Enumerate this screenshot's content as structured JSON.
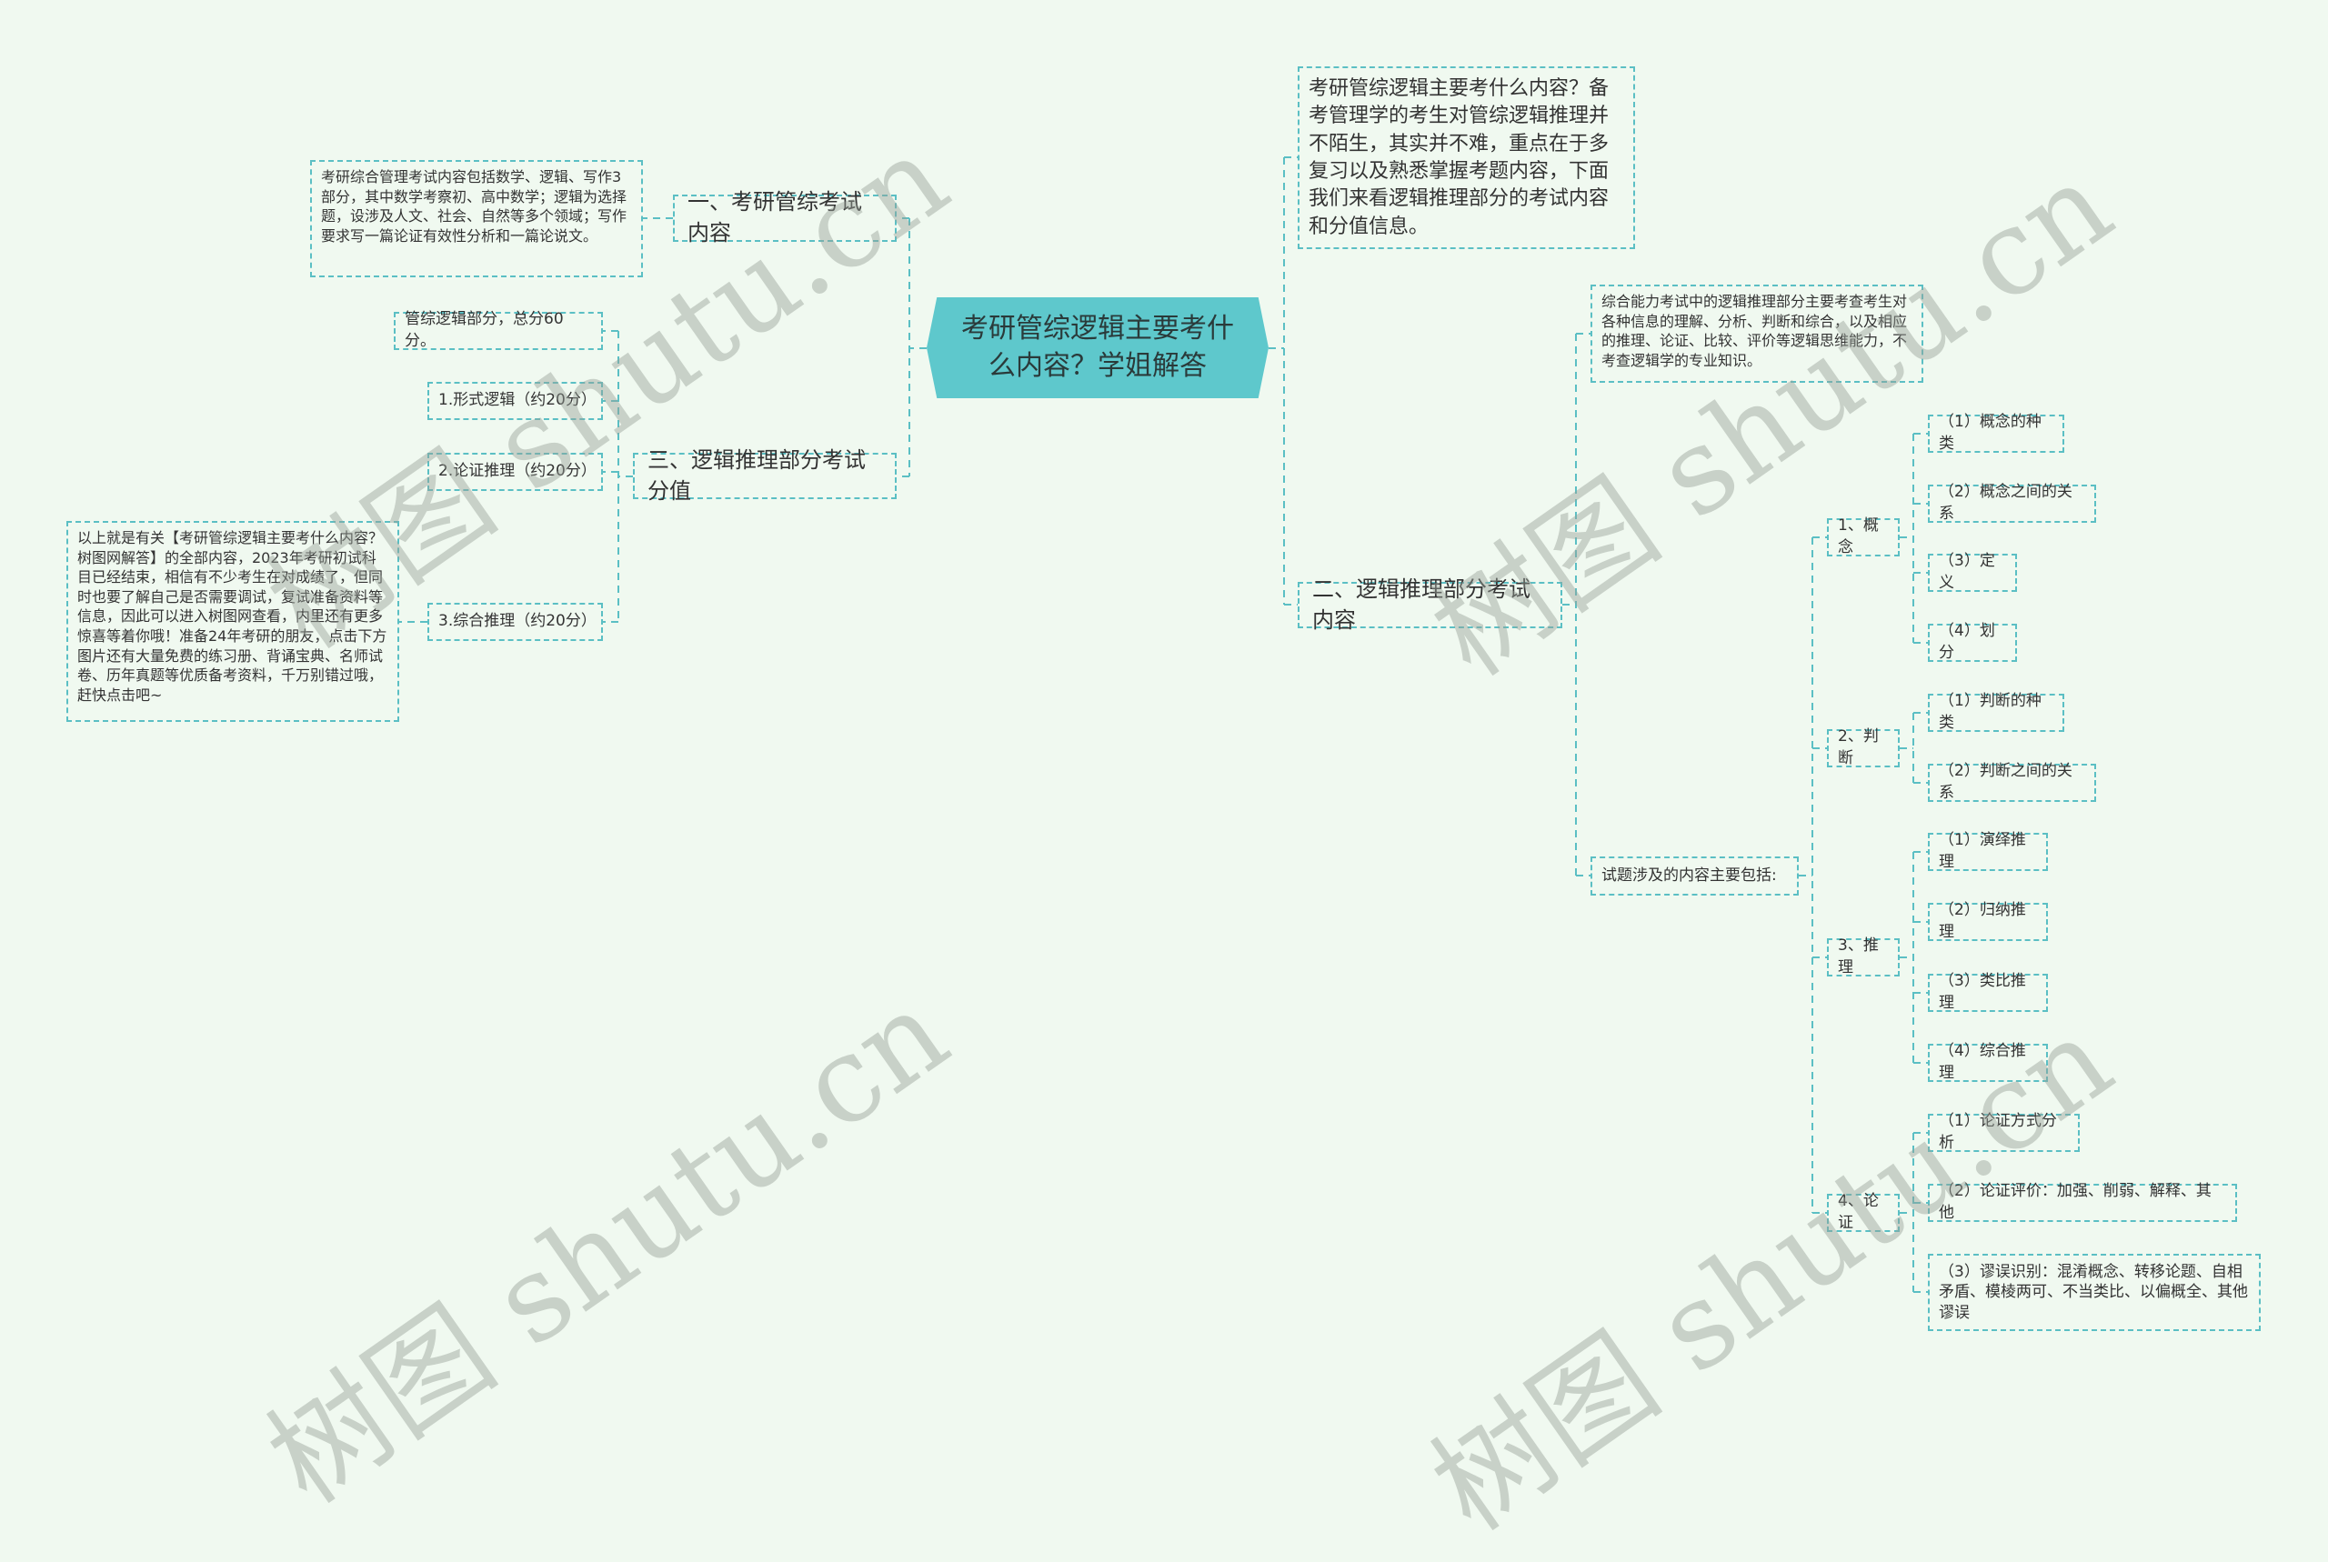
{
  "central": {
    "title": "考研管综逻辑主要考什么内容？学姐解答"
  },
  "intro": {
    "text": "考研管综逻辑主要考什么内容？备考管理学的考生对管综逻辑推理并不陌生，其实并不难，重点在于多复习以及熟悉掌握考题内容，下面我们来看逻辑推理部分的考试内容和分值信息。"
  },
  "branch1": {
    "label": "一、考研管综考试内容",
    "detail": "考研综合管理考试内容包括数学、逻辑、写作3部分，其中数学考察初、高中数学；逻辑为选择题，设涉及人文、社会、自然等多个领域；写作要求写一篇论证有效性分析和一篇论说文。"
  },
  "branch2": {
    "label": "二、逻辑推理部分考试内容",
    "detail": "综合能力考试中的逻辑推理部分主要考查考生对各种信息的理解、分析、判断和综合，以及相应的推理、论证、比较、评价等逻辑思维能力，不考查逻辑学的专业知识。",
    "content_label": "试题涉及的内容主要包括:",
    "topics": [
      {
        "label": "1、概念",
        "items": [
          "（1）概念的种类",
          "（2）概念之间的关系",
          "（3）定义",
          "（4）划分"
        ]
      },
      {
        "label": "2、判断",
        "items": [
          "（1）判断的种类",
          "（2）判断之间的关系"
        ]
      },
      {
        "label": "3、推理",
        "items": [
          "（1）演绎推理",
          "（2）归纳推理",
          "（3）类比推理",
          "（4）综合推理"
        ]
      },
      {
        "label": "4、论证",
        "items": [
          "（1）论证方式分析",
          "（2）论证评价：加强、削弱、解释、其他",
          "（3）谬误识别：混淆概念、转移论题、自相矛盾、模棱两可、不当类比、以偏概全、其他谬误"
        ]
      }
    ]
  },
  "branch3": {
    "label": "三、逻辑推理部分考试分值",
    "items": [
      "管综逻辑部分，总分60分。",
      "1.形式逻辑（约20分）",
      "2.论证推理（约20分）",
      "3.综合推理（约20分）"
    ],
    "summary": "以上就是有关【考研管综逻辑主要考什么内容？树图网解答】的全部内容，2023年考研初试科目已经结束，相信有不少考生在对成绩了，但同时也要了解自己是否需要调试，复试准备资料等信息，因此可以进入树图网查看，内里还有更多惊喜等着你哦！准备24年考研的朋友，点击下方图片还有大量免费的练习册、背诵宝典、名师试卷、历年真题等优质备考资料，千万别错过哦，赶快点击吧~"
  },
  "watermark": {
    "text": "树图 shutu.cn"
  },
  "colors": {
    "background": "#f0f9f0",
    "central_fill": "#5ec8cc",
    "border": "#5bbfc4"
  }
}
